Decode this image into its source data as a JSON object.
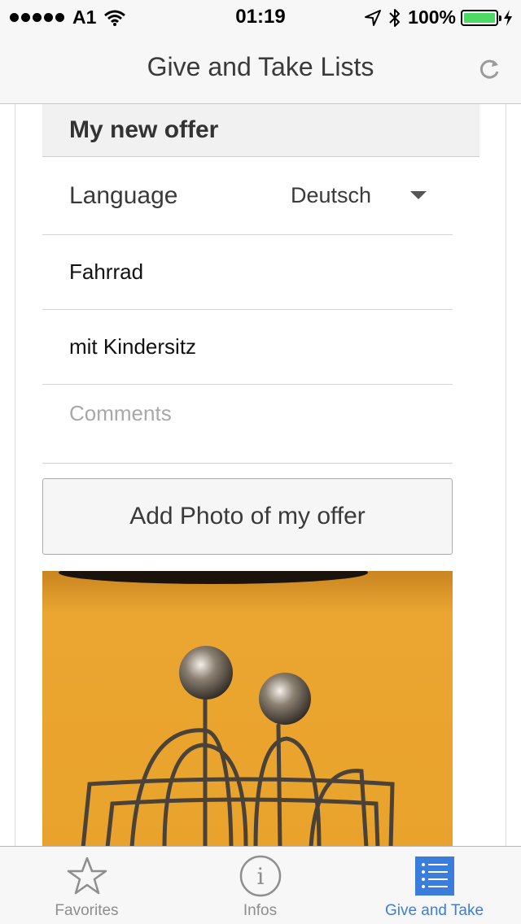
{
  "status_bar": {
    "carrier": "A1",
    "time": "01:19",
    "battery": "100%",
    "battery_level": 1.0
  },
  "nav": {
    "title": "Give and Take Lists",
    "refresh_icon": "refresh-icon"
  },
  "offer": {
    "header": "My new offer",
    "language_label": "Language",
    "language_value": "Deutsch",
    "title_value": "Fahrrad",
    "description_value": "mit Kindersitz",
    "comments_placeholder": "Comments",
    "add_photo_label": "Add Photo of my offer"
  },
  "tabs": [
    {
      "label": "Favorites",
      "icon": "star-icon",
      "active": false
    },
    {
      "label": "Infos",
      "icon": "info-icon",
      "active": false
    },
    {
      "label": "Give and Take",
      "icon": "list-icon",
      "active": true
    }
  ],
  "colors": {
    "accent": "#3b7ddd",
    "battery_fill": "#4cd964",
    "photo_background": "#e8a52f"
  }
}
